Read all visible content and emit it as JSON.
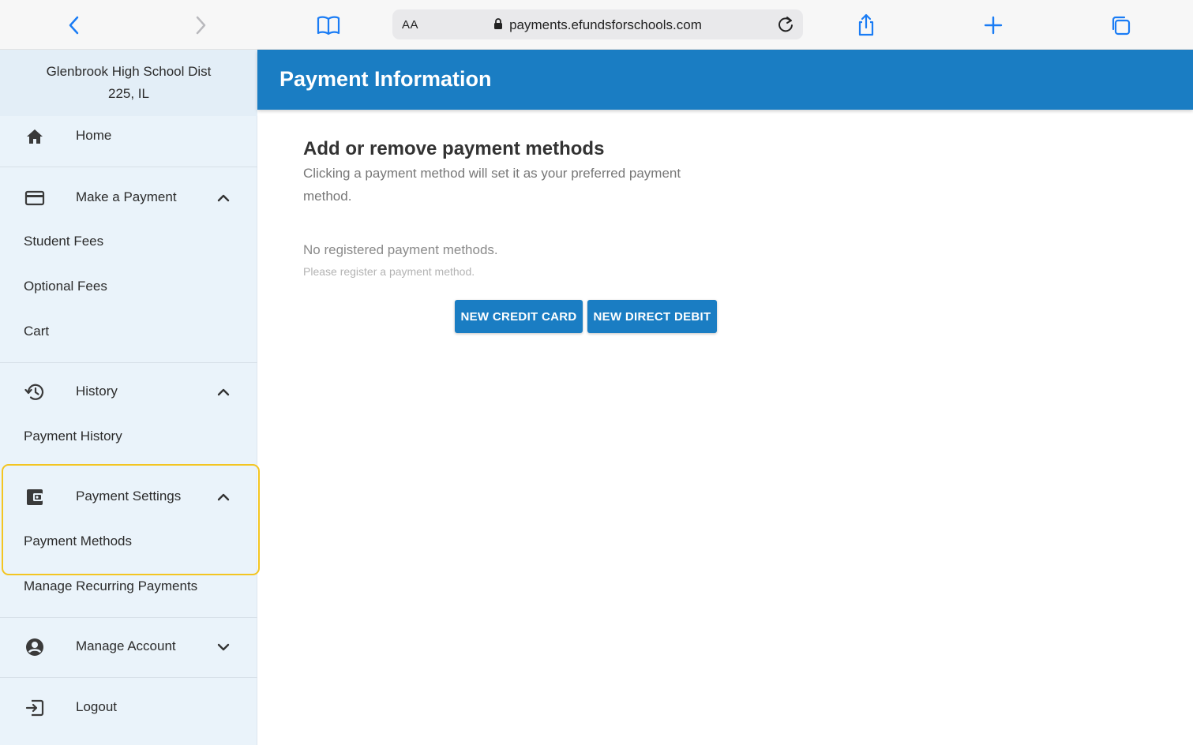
{
  "browser": {
    "text_size_label": "AA",
    "url": "payments.efundsforschools.com",
    "icons": [
      "back-icon",
      "forward-icon",
      "bookmarks-icon",
      "lock-icon",
      "reload-icon",
      "share-icon",
      "new-tab-icon",
      "tabs-icon"
    ]
  },
  "sidebar": {
    "school_name": "Glenbrook High School Dist 225, IL",
    "home": "Home",
    "make_payment": "Make a Payment",
    "student_fees": "Student Fees",
    "optional_fees": "Optional Fees",
    "cart": "Cart",
    "history": "History",
    "payment_history": "Payment History",
    "payment_settings": "Payment Settings",
    "payment_methods": "Payment Methods",
    "manage_recurring": "Manage Recurring Payments",
    "manage_account": "Manage Account",
    "logout": "Logout"
  },
  "main": {
    "header_title": "Payment Information",
    "section_title": "Add or remove payment methods",
    "section_description": "Clicking a payment method will set it as your preferred payment method.",
    "empty_title": "No registered payment methods.",
    "empty_subtitle": "Please register a payment method.",
    "new_credit_card": "NEW CREDIT CARD",
    "new_direct_debit": "NEW DIRECT DEBIT"
  },
  "colors": {
    "accent": "#1a7dc3",
    "highlight": "#f3c521",
    "sidebar_bg": "#eaf3fa",
    "browser_blue": "#1a7cf5"
  }
}
